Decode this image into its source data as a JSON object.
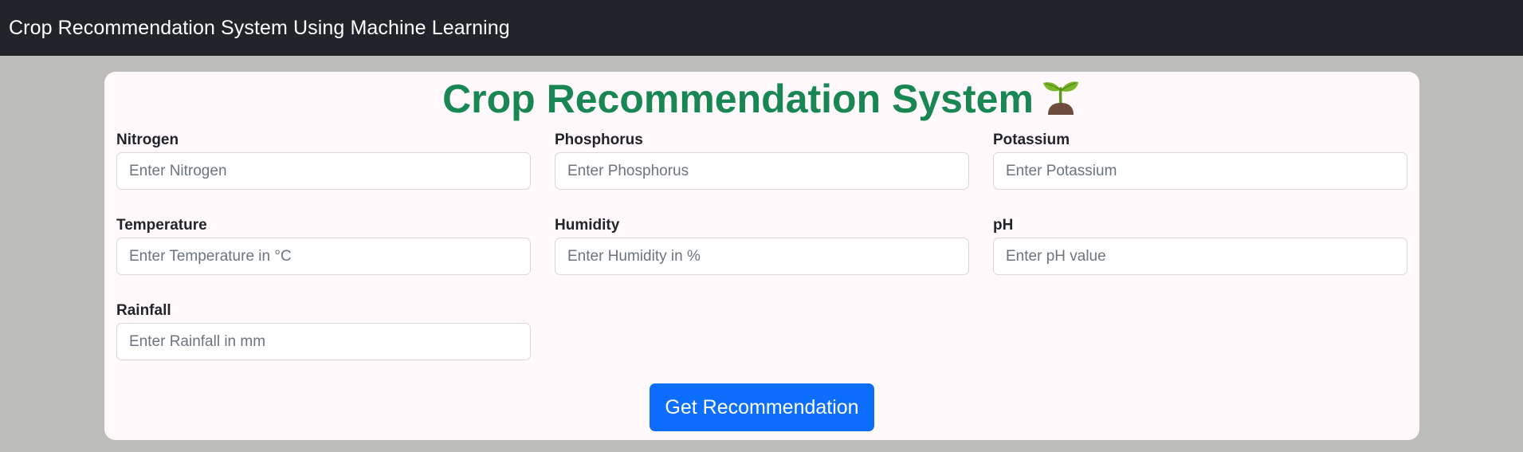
{
  "navbar": {
    "brand": "Crop Recommendation System Using Machine Learning"
  },
  "card": {
    "title": "Crop Recommendation System",
    "title_icon": "sprout-icon",
    "fields": [
      {
        "label": "Nitrogen",
        "placeholder": "Enter Nitrogen",
        "value": ""
      },
      {
        "label": "Phosphorus",
        "placeholder": "Enter Phosphorus",
        "value": ""
      },
      {
        "label": "Potassium",
        "placeholder": "Enter Potassium",
        "value": ""
      },
      {
        "label": "Temperature",
        "placeholder": "Enter Temperature in °C",
        "value": ""
      },
      {
        "label": "Humidity",
        "placeholder": "Enter Humidity in %",
        "value": ""
      },
      {
        "label": "pH",
        "placeholder": "Enter pH value",
        "value": ""
      },
      {
        "label": "Rainfall",
        "placeholder": "Enter Rainfall in mm",
        "value": ""
      }
    ],
    "submit_label": "Get Recommendation"
  },
  "colors": {
    "navbar_bg": "#212529",
    "page_bg": "#bcbcb8",
    "card_bg": "#fff9fc",
    "title_green": "#198754",
    "button_blue": "#0d6efd"
  }
}
